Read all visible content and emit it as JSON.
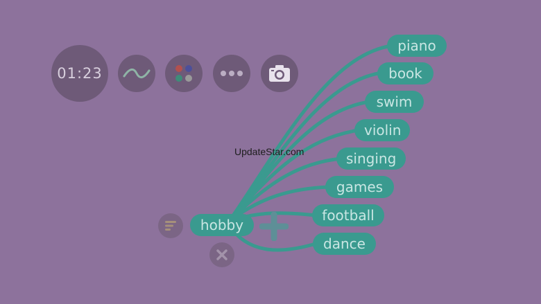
{
  "timer": {
    "display": "01:23"
  },
  "toolbar": {
    "curve_icon": "wave-curve-icon",
    "colors_icon": "color-dots-icon",
    "more_icon": "more-dots-icon",
    "camera_icon": "camera-icon"
  },
  "mindmap": {
    "root": {
      "label": "hobby"
    },
    "branches": [
      {
        "label": "piano"
      },
      {
        "label": "book"
      },
      {
        "label": "swim"
      },
      {
        "label": "violin"
      },
      {
        "label": "singing"
      },
      {
        "label": "games"
      },
      {
        "label": "football"
      },
      {
        "label": "dance"
      }
    ]
  },
  "watermark": "UpdateStar.com",
  "colors": {
    "background": "#8d729c",
    "node": "#3a9a8f",
    "connector": "#3a9a8f",
    "toolbar_circle": "#6e5a78"
  }
}
